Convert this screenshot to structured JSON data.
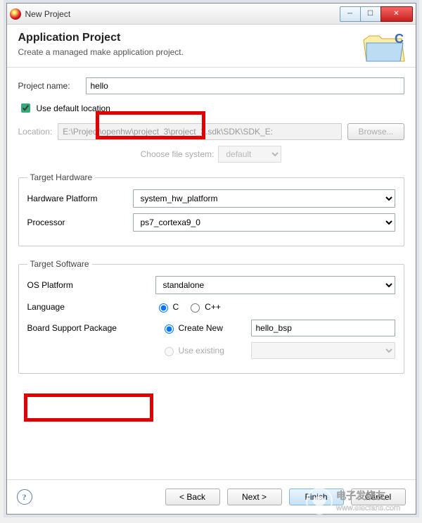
{
  "window": {
    "title": "New Project"
  },
  "header": {
    "title": "Application Project",
    "subtitle": "Create a managed make application project."
  },
  "project": {
    "name_label": "Project name:",
    "name_value": "hello",
    "use_default_label": "Use default location",
    "use_default_checked": true,
    "location_label": "Location:",
    "location_value": "E:\\Project\\openhw\\project_3\\project_3.sdk\\SDK\\SDK_E:",
    "browse_label": "Browse...",
    "fs_label": "Choose file system:",
    "fs_value": "default"
  },
  "hardware": {
    "legend": "Target Hardware",
    "platform_label": "Hardware Platform",
    "platform_value": "system_hw_platform",
    "processor_label": "Processor",
    "processor_value": "ps7_cortexa9_0"
  },
  "software": {
    "legend": "Target Software",
    "os_label": "OS Platform",
    "os_value": "standalone",
    "lang_label": "Language",
    "lang_c": "C",
    "lang_cpp": "C++",
    "bsp_label": "Board Support Package",
    "bsp_create_label": "Create New",
    "bsp_name": "hello_bsp",
    "bsp_existing_label": "Use existing"
  },
  "footer": {
    "back": "< Back",
    "next": "Next >",
    "finish": "Finish",
    "cancel": "Cancel"
  },
  "watermark": {
    "text1": "电子发烧友",
    "text2": "www.elecfans.com"
  }
}
